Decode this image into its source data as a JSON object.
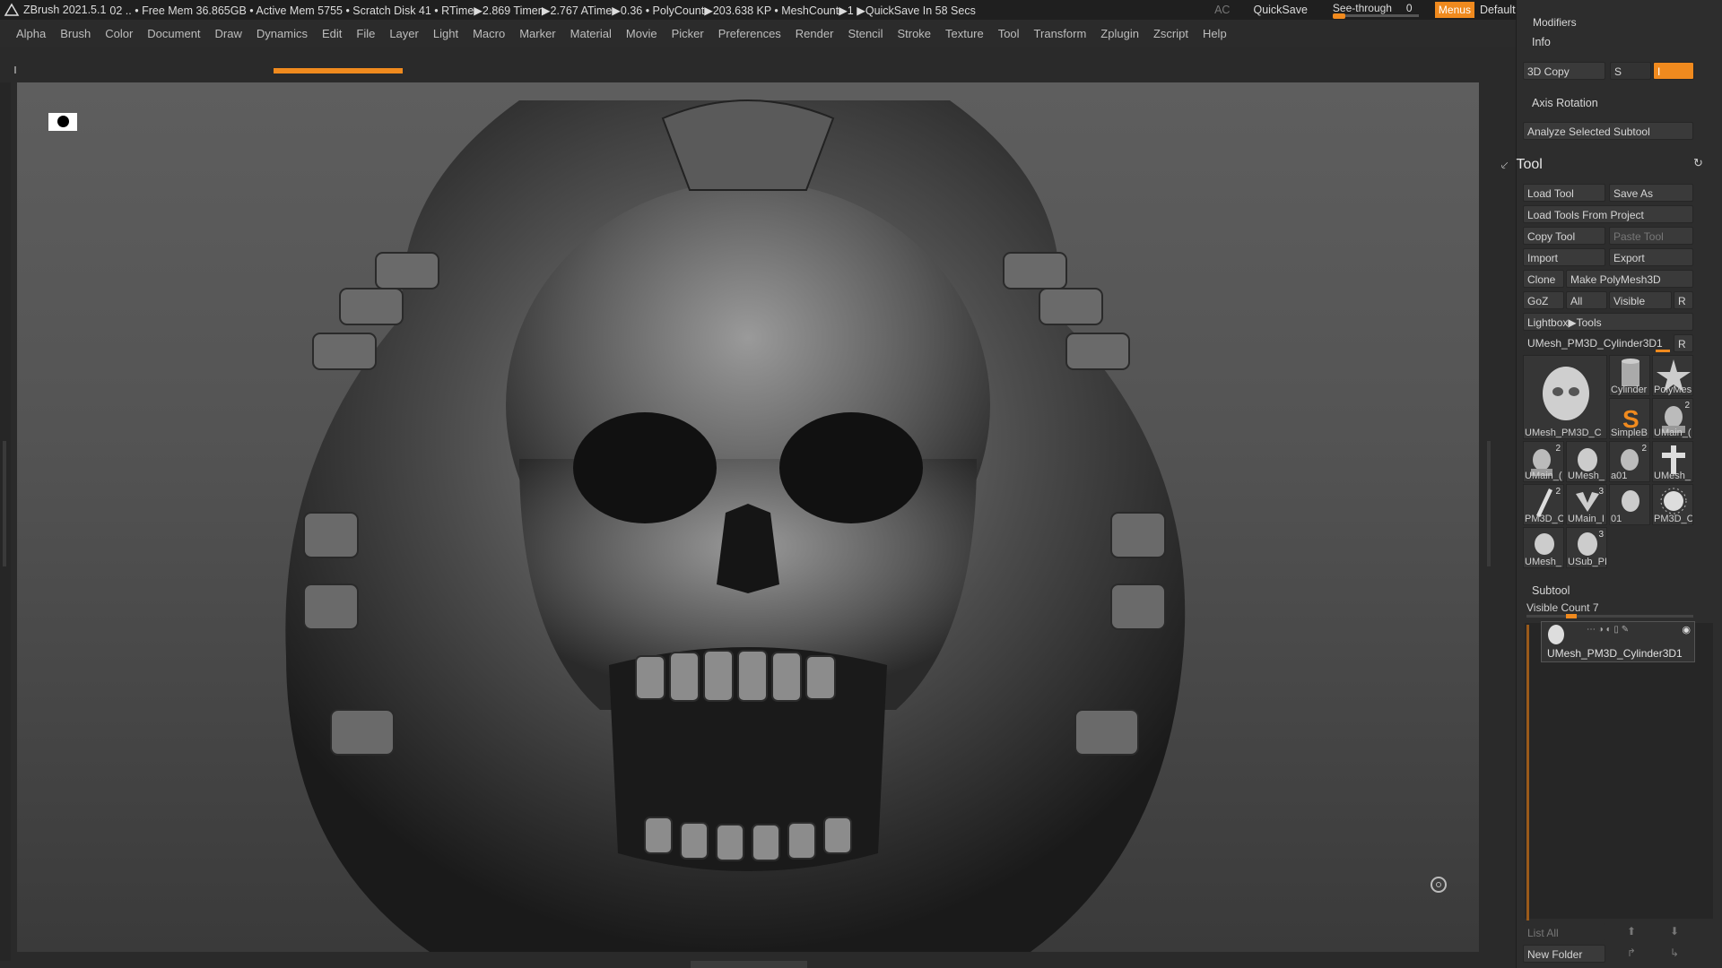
{
  "titlebar": {
    "app": "ZBrush 2021.5.1",
    "stats": "02  .. • Free Mem 36.865GB • Active Mem 5755 • Scratch Disk 41 •  RTime▶2.869 Timer▶2.767 ATime▶0.36 • PolyCount▶203.638 KP  • MeshCount▶1  ▶QuickSave In 58 Secs",
    "ac": "AC",
    "quicksave": "QuickSave",
    "see_through_label": "See-through",
    "see_through_value": "0",
    "menus": "Menus",
    "default_zscript": "DefaultZScript"
  },
  "menubar": [
    "Alpha",
    "Brush",
    "Color",
    "Document",
    "Draw",
    "Dynamics",
    "Edit",
    "File",
    "Layer",
    "Light",
    "Macro",
    "Marker",
    "Material",
    "Movie",
    "Picker",
    "Preferences",
    "Render",
    "Stencil",
    "Stroke",
    "Texture",
    "Tool",
    "Transform",
    "Zplugin",
    "Zscript",
    "Help"
  ],
  "panel": {
    "modifiers": "Modifiers",
    "info": "Info",
    "copy3d": "3D Copy",
    "s_label": "S",
    "i_label": "I",
    "axis_rotation": "Axis Rotation",
    "analyze": "Analyze Selected Subtool",
    "tool_title": "Tool",
    "load_tool": "Load Tool",
    "save_as": "Save As",
    "load_tools_from_project": "Load Tools From Project",
    "copy_tool": "Copy Tool",
    "paste_tool": "Paste Tool",
    "import": "Import",
    "export": "Export",
    "clone": "Clone",
    "make_polymesh": "Make PolyMesh3D",
    "goz": "GoZ",
    "all": "All",
    "visible": "Visible",
    "r": "R",
    "lightbox_tools": "Lightbox▶Tools",
    "current_tool": "UMesh_PM3D_Cylinder3D1",
    "thumbs": [
      {
        "label": "UMesh_PM3D_C",
        "count": ""
      },
      {
        "label": "Cylinder",
        "count": ""
      },
      {
        "label": "PolyMes",
        "count": ""
      },
      {
        "label": "SimpleB",
        "count": ""
      },
      {
        "label": "UMain_(",
        "count": "2"
      },
      {
        "label": "UMain_(",
        "count": "2"
      },
      {
        "label": "UMesh_",
        "count": ""
      },
      {
        "label": "a01",
        "count": "2"
      },
      {
        "label": "UMesh_",
        "count": ""
      },
      {
        "label": "PM3D_C",
        "count": "2"
      },
      {
        "label": "UMain_I",
        "count": "3"
      },
      {
        "label": "01",
        "count": ""
      },
      {
        "label": "PM3D_C",
        "count": ""
      },
      {
        "label": "UMesh_",
        "count": ""
      },
      {
        "label": "USub_PI",
        "count": "3"
      }
    ],
    "subtool_title": "Subtool",
    "visible_count": "Visible Count 7",
    "subtool_item": "UMesh_PM3D_Cylinder3D1",
    "list_all": "List All",
    "new_folder": "New Folder"
  },
  "colors": {
    "accent": "#f08a1e",
    "panel": "#2d2d2d",
    "menubar": "#2b2b2b"
  },
  "progress": {
    "fill_fraction": 0.09
  }
}
